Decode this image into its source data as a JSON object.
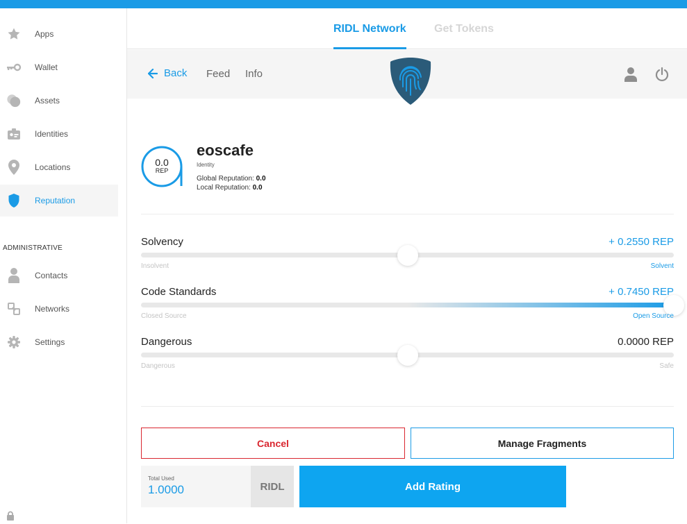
{
  "sidebar": {
    "items": [
      {
        "label": "Apps",
        "icon": "star-icon"
      },
      {
        "label": "Wallet",
        "icon": "key-icon"
      },
      {
        "label": "Assets",
        "icon": "coins-icon"
      },
      {
        "label": "Identities",
        "icon": "id-card-icon"
      },
      {
        "label": "Locations",
        "icon": "location-pin-icon"
      },
      {
        "label": "Reputation",
        "icon": "shield-icon",
        "active": true
      }
    ],
    "admin_title": "ADMINISTRATIVE",
    "admin_items": [
      {
        "label": "Contacts",
        "icon": "person-icon"
      },
      {
        "label": "Networks",
        "icon": "network-icon"
      },
      {
        "label": "Settings",
        "icon": "gear-icon"
      }
    ]
  },
  "tabs": [
    {
      "label": "RIDL Network",
      "active": true
    },
    {
      "label": "Get Tokens",
      "active": false
    }
  ],
  "toolbar": {
    "back_label": "Back",
    "feed_label": "Feed",
    "info_label": "Info"
  },
  "identity": {
    "rep_value": "0.0",
    "rep_unit": "REP",
    "name": "eoscafe",
    "type": "Identity",
    "global_label": "Global Reputation:",
    "global_value": "0.0",
    "local_label": "Local Reputation:",
    "local_value": "0.0"
  },
  "fragments": [
    {
      "name": "Solvency",
      "value": "+ 0.2550 REP",
      "min_label": "Insolvent",
      "max_label": "Solvent",
      "position": 0.5,
      "fill": 0.0
    },
    {
      "name": "Code Standards",
      "value": "+ 0.7450 REP",
      "min_label": "Closed Source",
      "max_label": "Open Source",
      "position": 1.0,
      "fill": 0.5
    },
    {
      "name": "Dangerous",
      "value": "0.0000 REP",
      "min_label": "Dangerous",
      "max_label": "Safe",
      "position": 0.5,
      "fill": 0.0
    }
  ],
  "actions": {
    "cancel_label": "Cancel",
    "manage_label": "Manage Fragments",
    "total_label": "Total Used",
    "total_value": "1.0000",
    "token": "RIDL",
    "add_label": "Add Rating"
  },
  "colors": {
    "accent": "#1a9be6",
    "danger": "#d9262f"
  }
}
